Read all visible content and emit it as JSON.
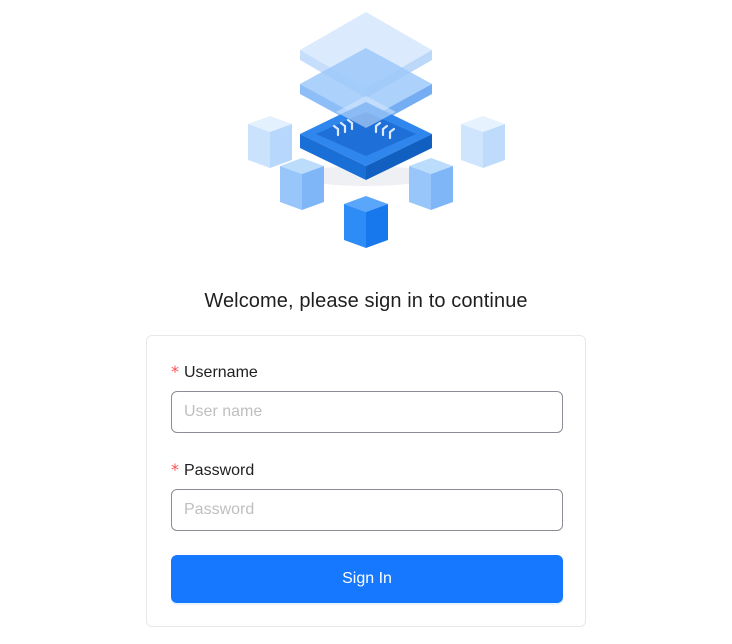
{
  "page": {
    "heading": "Welcome, please sign in to continue"
  },
  "form": {
    "username": {
      "label": "Username",
      "required_mark": "*",
      "placeholder": "User name",
      "value": ""
    },
    "password": {
      "label": "Password",
      "required_mark": "*",
      "placeholder": "Password",
      "value": ""
    },
    "submit_label": "Sign In"
  },
  "colors": {
    "primary": "#1677ff",
    "required": "#ff4d4f",
    "illustration_dark": "#1b74e4",
    "illustration_light": "#b9dafd"
  },
  "icons": {
    "hero": "isometric-chip-cubes-illustration"
  }
}
